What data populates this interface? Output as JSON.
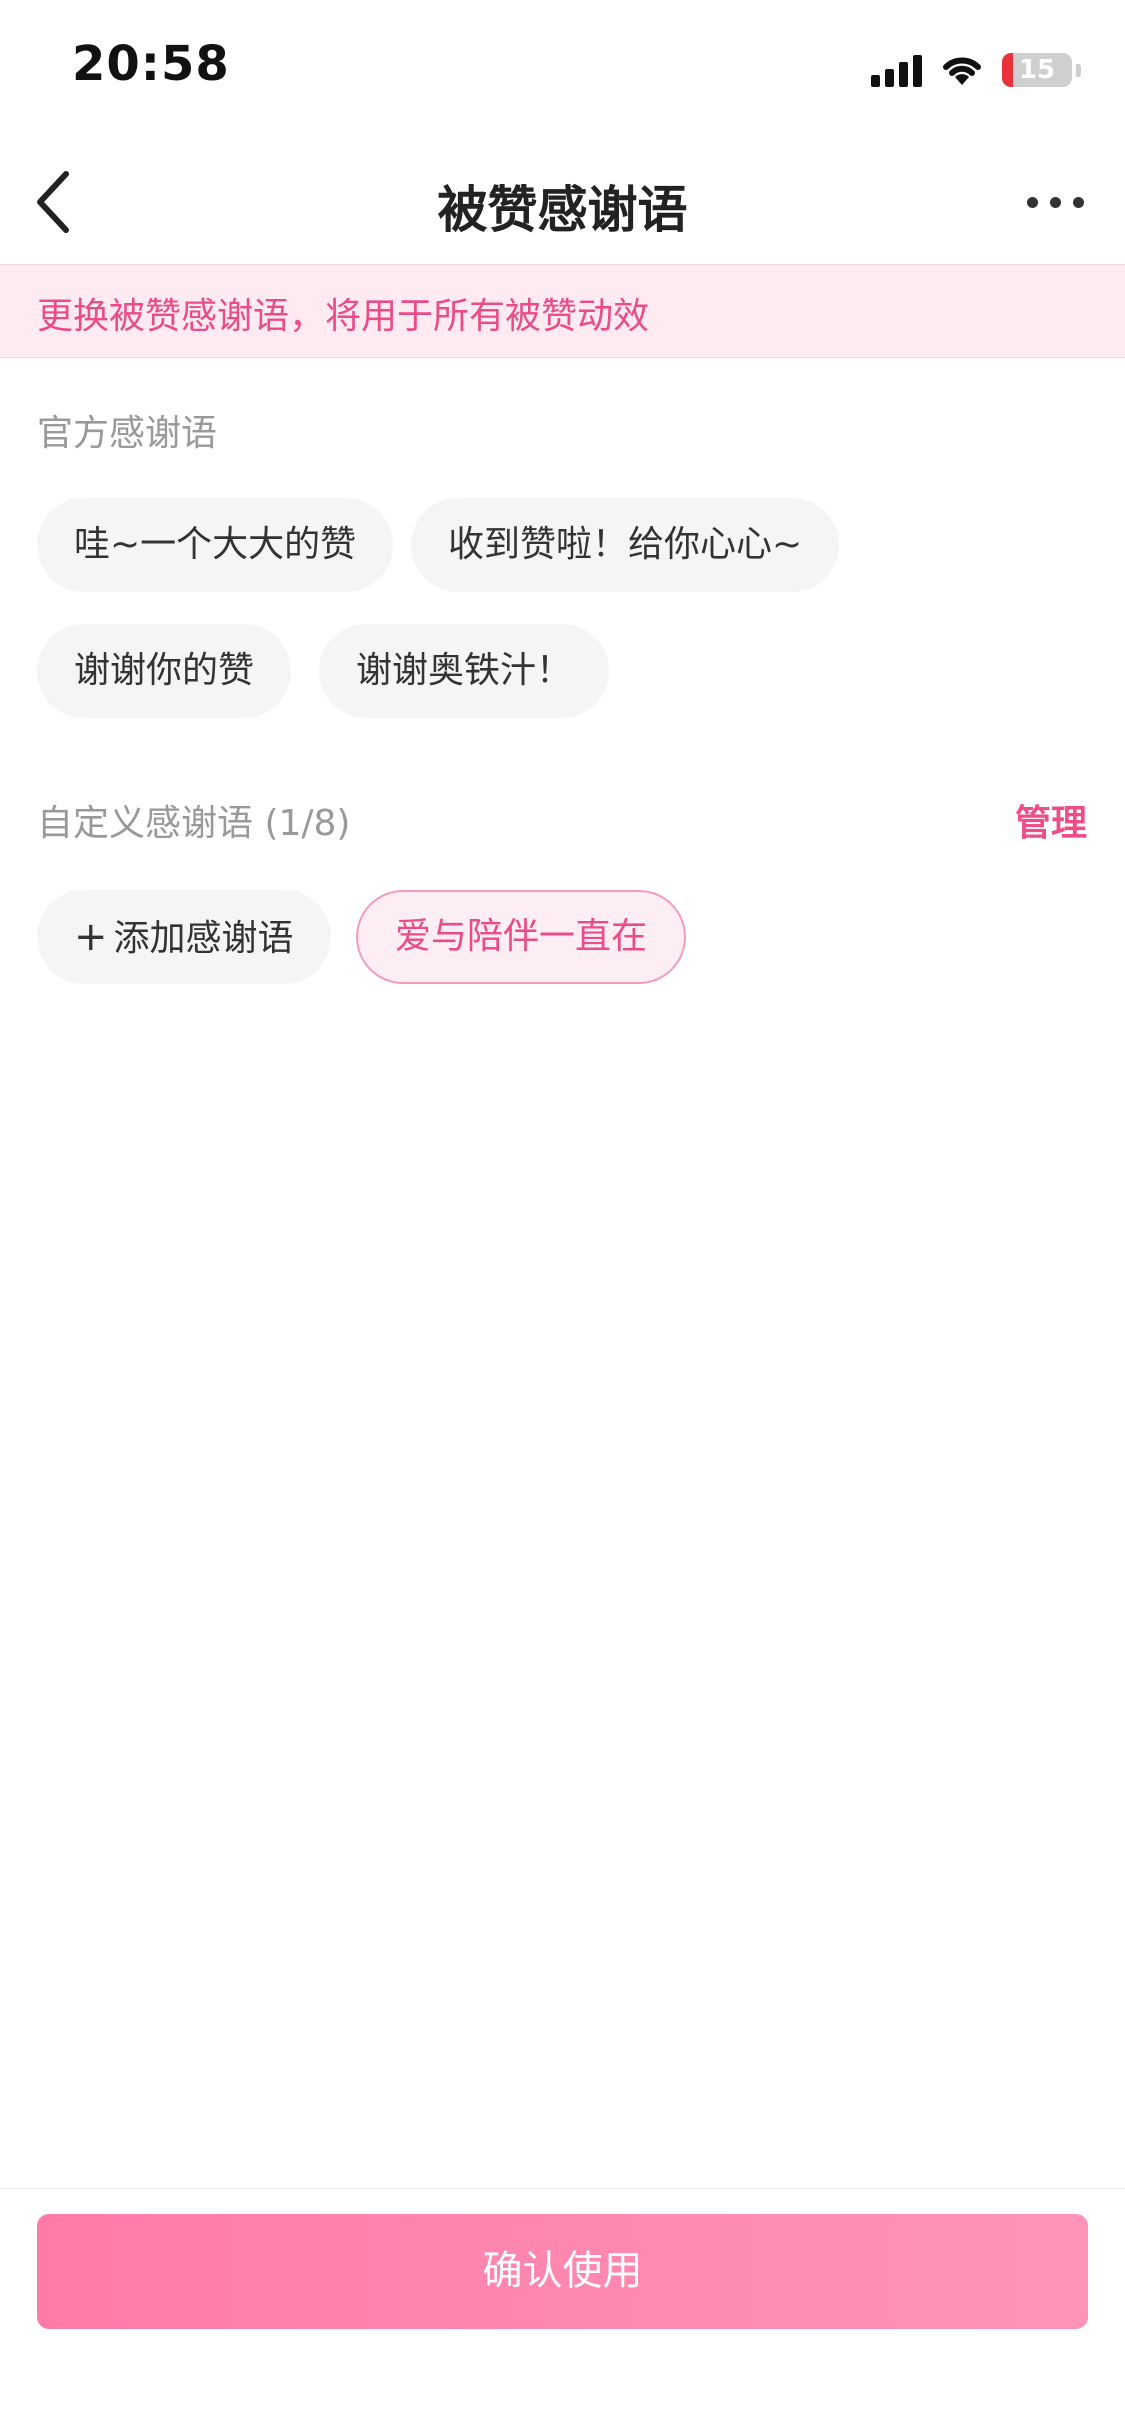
{
  "status_bar": {
    "time": "20:58",
    "battery": "15",
    "battery_level_percent": 15
  },
  "nav": {
    "title": "被赞感谢语",
    "back_icon": "chevron-left-icon",
    "more_icon": "more-horizontal-icon"
  },
  "banner": {
    "text": "更换被赞感谢语，将用于所有被赞动效"
  },
  "official": {
    "label": "官方感谢语",
    "chips": [
      "哇~一个大大的赞",
      "收到赞啦！给你心心~",
      "谢谢你的赞",
      "谢谢奥铁汁！"
    ]
  },
  "custom": {
    "label": "自定义感谢语 (1/8)",
    "manage_label": "管理",
    "add_icon": "plus-icon",
    "add_label": "添加感谢语",
    "chips": [
      "爱与陪伴一直在"
    ],
    "selected_index": 0
  },
  "confirm_label": "确认使用",
  "colors": {
    "accent": "#ea4c89",
    "banner_bg": "#fdebf1",
    "button_start": "#ff7ba7",
    "button_end": "#fe93b8"
  }
}
